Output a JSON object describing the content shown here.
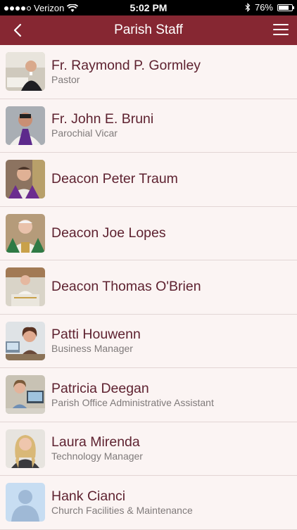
{
  "status_bar": {
    "carrier": "Verizon",
    "time": "5:02 PM",
    "battery": "76%",
    "battery_level": 0.76
  },
  "nav": {
    "title": "Parish Staff",
    "back_icon": "chevron-left-icon",
    "menu_icon": "hamburger-menu-icon"
  },
  "colors": {
    "nav_background": "#862732",
    "name_text": "#5e2230",
    "role_text": "#7f7a7a",
    "list_background": "#fbf4f3"
  },
  "staff": [
    {
      "name": "Fr. Raymond P. Gormley",
      "role": "Pastor",
      "photo": "priest-portrait"
    },
    {
      "name": "Fr. John E. Bruni",
      "role": "Parochial Vicar",
      "photo": "priest-in-purple-vestment"
    },
    {
      "name": "Deacon Peter Traum",
      "role": "",
      "photo": "deacon-in-purple-vestment"
    },
    {
      "name": "Deacon Joe Lopes",
      "role": "",
      "photo": "deacon-in-green-vestment"
    },
    {
      "name": "Deacon Thomas O'Brien",
      "role": "",
      "photo": "deacon-at-ambo"
    },
    {
      "name": "Patti Houwenn",
      "role": "Business Manager",
      "photo": "woman-at-desk"
    },
    {
      "name": "Patricia Deegan",
      "role": "Parish Office Administrative Assistant",
      "photo": "woman-at-computer"
    },
    {
      "name": "Laura Mirenda",
      "role": "Technology Manager",
      "photo": "woman-with-long-hair"
    },
    {
      "name": "Hank Cianci",
      "role": "Church Facilities & Maintenance",
      "photo": "default-person-silhouette"
    }
  ]
}
